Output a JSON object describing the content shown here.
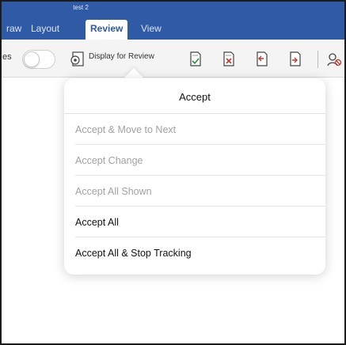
{
  "window": {
    "doc_title": "test 2"
  },
  "tabs": [
    {
      "label": "raw",
      "active": false
    },
    {
      "label": "Layout",
      "active": false
    },
    {
      "label": "Review",
      "active": true
    },
    {
      "label": "View",
      "active": false
    }
  ],
  "toolbar": {
    "track_changes_label_partial": "es",
    "track_changes_on": false,
    "display_for_review_label": "Display for Review",
    "icons": [
      "accept-change-icon",
      "reject-change-icon",
      "previous-change-icon",
      "next-change-icon",
      "authors-icon"
    ]
  },
  "popover": {
    "title": "Accept",
    "items": [
      {
        "label": "Accept & Move to Next",
        "enabled": false
      },
      {
        "label": "Accept Change",
        "enabled": false
      },
      {
        "label": "Accept All Shown",
        "enabled": false
      },
      {
        "label": "Accept All",
        "enabled": true
      },
      {
        "label": "Accept All & Stop Tracking",
        "enabled": true
      }
    ]
  },
  "colors": {
    "ribbon": "#2f5aa6",
    "toolbar": "#f4f4f4",
    "disabled_text": "#a2a2a2",
    "enabled_text": "#111111"
  }
}
